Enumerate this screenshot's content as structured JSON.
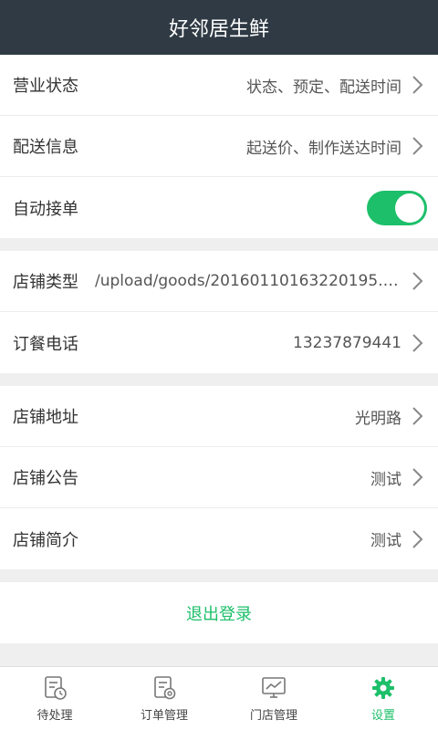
{
  "header": {
    "title": "好邻居生鲜"
  },
  "colors": {
    "accent": "#1dbf6a",
    "header_bg": "#2f3a44"
  },
  "sections": [
    {
      "rows": [
        {
          "label": "营业状态",
          "value": "状态、预定、配送时间"
        },
        {
          "label": "配送信息",
          "value": "起送价、制作送达时间"
        },
        {
          "label": "自动接单",
          "toggle_on": true
        }
      ]
    },
    {
      "rows": [
        {
          "label": "店铺类型",
          "value": "/upload/goods/20160110163220195.png"
        },
        {
          "label": "订餐电话",
          "value": "13237879441"
        }
      ]
    },
    {
      "rows": [
        {
          "label": "店铺地址",
          "value": "光明路"
        },
        {
          "label": "店铺公告",
          "value": "测试"
        },
        {
          "label": "店铺简介",
          "value": "测试"
        }
      ]
    }
  ],
  "logout_label": "退出登录",
  "tabs": [
    {
      "label": "待处理",
      "icon": "clock-doc-icon",
      "active": false
    },
    {
      "label": "订单管理",
      "icon": "order-gear-icon",
      "active": false
    },
    {
      "label": "门店管理",
      "icon": "chart-monitor-icon",
      "active": false
    },
    {
      "label": "设置",
      "icon": "gear-icon",
      "active": true
    }
  ]
}
